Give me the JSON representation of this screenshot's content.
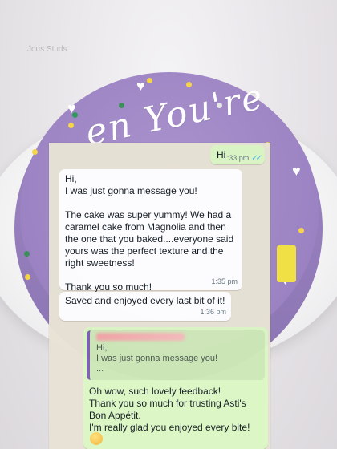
{
  "watermark": "Jous Studs",
  "cake": {
    "piping_text": "en You're"
  },
  "messages": [
    {
      "direction": "outgoing",
      "text": "Hi",
      "time": "1:33 pm",
      "status_icon": "double-check-read-icon"
    },
    {
      "direction": "incoming",
      "text": "Hi,\nI was just gonna message you!\n\nThe cake was super yummy! We had a caramel cake from Magnolia and then the one that you baked....everyone said yours was the perfect texture and the right sweetness!\n\nThank you so much!",
      "time": "1:35 pm"
    },
    {
      "direction": "incoming",
      "text": "Saved and enjoyed every last bit of it!",
      "time": "1:36 pm"
    },
    {
      "direction": "outgoing",
      "quoted": {
        "author": "",
        "text": "Hi,\nI was just gonna message you!\n..."
      },
      "text": "Oh wow, such lovely feedback!\nThank you so much for trusting Asti's Bon Appétit.\nI'm really glad you enjoyed every bite!",
      "emoji": "smiling-face-emoji"
    }
  ],
  "colors": {
    "incoming_bubble": "#ffffff",
    "outgoing_bubble": "#dcf7c5",
    "chat_background": "#e8e3d5",
    "read_ticks": "#53bdeb",
    "cake_frosting": "#9c83c3"
  }
}
